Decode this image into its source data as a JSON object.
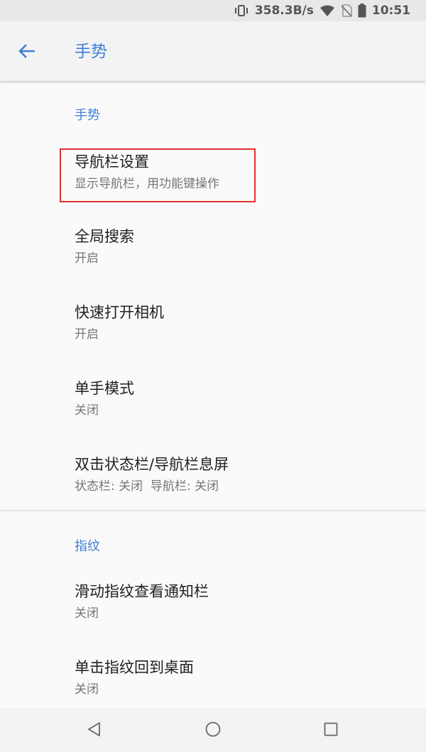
{
  "status_bar": {
    "net_speed": "358.3B/s",
    "time": "10:51",
    "icons": [
      "vibrate-icon",
      "wifi-icon",
      "no-sim-icon",
      "battery-icon"
    ]
  },
  "app_bar": {
    "title": "手势",
    "back_icon": "arrow-left-icon",
    "accent_color": "#3f7fd6"
  },
  "sections": [
    {
      "header": "手势",
      "items": [
        {
          "title": "导航栏设置",
          "summary": "显示导航栏，用功能键操作",
          "highlighted": true
        },
        {
          "title": "全局搜索",
          "summary": "开启"
        },
        {
          "title": "快速打开相机",
          "summary": "开启"
        },
        {
          "title": "单手模式",
          "summary": "关闭"
        },
        {
          "title": "双击状态栏/导航栏息屏",
          "summary": "状态栏: 关闭  导航栏: 关闭"
        }
      ]
    },
    {
      "header": "指纹",
      "items": [
        {
          "title": "滑动指纹查看通知栏",
          "summary": "关闭"
        },
        {
          "title": "单击指纹回到桌面",
          "summary": "关闭"
        }
      ]
    }
  ],
  "nav_bar": {
    "buttons": [
      "back-triangle-icon",
      "home-circle-icon",
      "recents-square-icon"
    ]
  },
  "highlight_color": "#e03030"
}
